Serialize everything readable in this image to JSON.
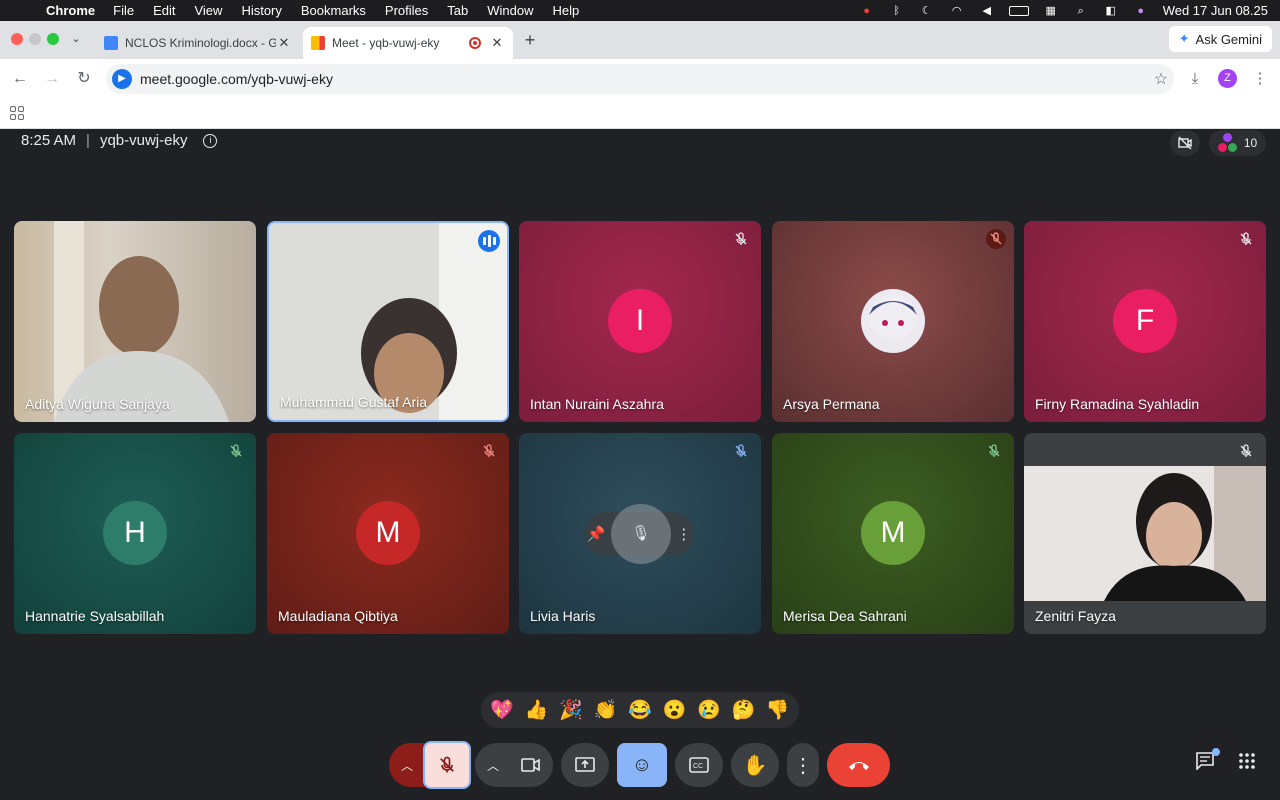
{
  "menubar": {
    "app": "Chrome",
    "items": [
      "File",
      "Edit",
      "View",
      "History",
      "Bookmarks",
      "Profiles",
      "Tab",
      "Window",
      "Help"
    ],
    "datetime": "Wed 17 Jun  08.25"
  },
  "tabs": [
    {
      "title": "NCLOS Kriminologi.docx - Go",
      "close": "✕"
    },
    {
      "title": "Meet - yqb-vuwj-eky",
      "close": "✕"
    }
  ],
  "new_tab": "+",
  "ask_gemini": "Ask Gemini",
  "omnibox": {
    "url": "meet.google.com/yqb-vuwj-eky"
  },
  "profile_initial": "Z",
  "meeting": {
    "time": "8:25 AM",
    "code": "yqb-vuwj-eky",
    "people_count": "10"
  },
  "participants": [
    {
      "name": "Aditya Wiguna Sanjaya",
      "type": "video"
    },
    {
      "name": "Muhammad Gustaf Aria",
      "type": "video"
    },
    {
      "name": "Intan Nuraini Aszahra",
      "initial": "I",
      "color": "#e91e63"
    },
    {
      "name": "Arsya Permana",
      "type": "avatar-image"
    },
    {
      "name": "Firny Ramadina Syahladin",
      "initial": "F",
      "color": "#e91e63"
    },
    {
      "name": "Hannatrie Syalsabillah",
      "initial": "H",
      "color": "#2e7d6a"
    },
    {
      "name": "Mauladiana Qibtiya",
      "initial": "M",
      "color": "#c62828"
    },
    {
      "name": "Livia Haris",
      "type": "hover"
    },
    {
      "name": "Merisa Dea Sahrani",
      "initial": "M",
      "color": "#689f38"
    },
    {
      "name": "Zenitri Fayza",
      "type": "video"
    }
  ],
  "reactions": [
    "💖",
    "👍",
    "🎉",
    "👏",
    "😂",
    "😮",
    "😢",
    "🤔",
    "👎"
  ]
}
